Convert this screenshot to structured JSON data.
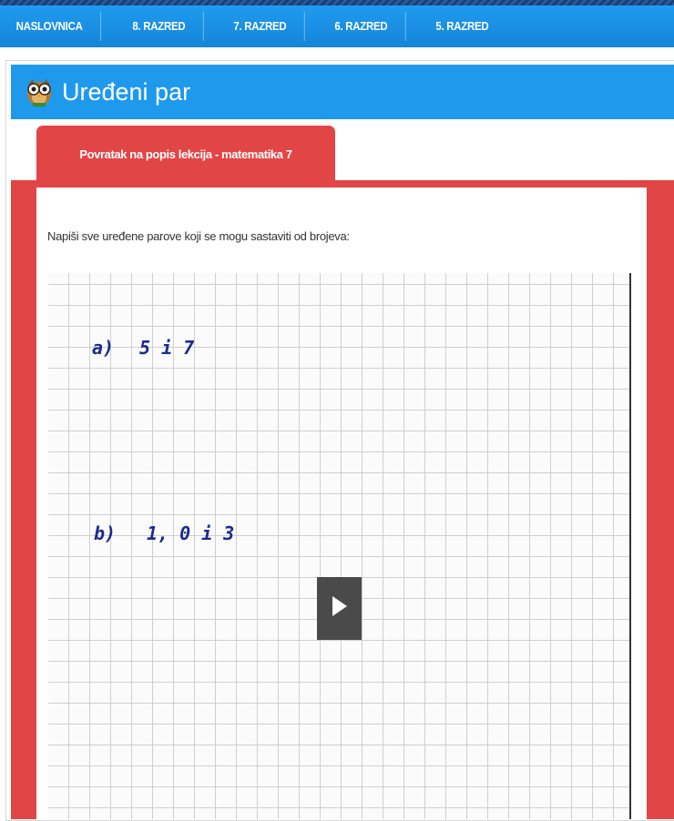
{
  "nav": {
    "items": [
      "NASLOVNICA",
      "8. RAZRED",
      "7. RAZRED",
      "6. RAZRED",
      "5. RAZRED"
    ]
  },
  "header": {
    "title": "Uređeni par",
    "icon": "owl-icon"
  },
  "tab": {
    "label": "Povratak na popis lekcija - matematika 7"
  },
  "content": {
    "instruction": "Napiši sve uređene parove koji se mogu sastaviti od brojeva:"
  },
  "video": {
    "line_a_label": "a)",
    "line_a_numbers": "5 i 7",
    "line_b_label": "b)",
    "line_b_numbers": "1, 0 i 3",
    "play_icon": "play-icon"
  },
  "colors": {
    "nav_blue": "#1585d9",
    "title_blue": "#1e99ec",
    "accent_red": "#e24546",
    "ink_blue": "#1a2a8f"
  }
}
